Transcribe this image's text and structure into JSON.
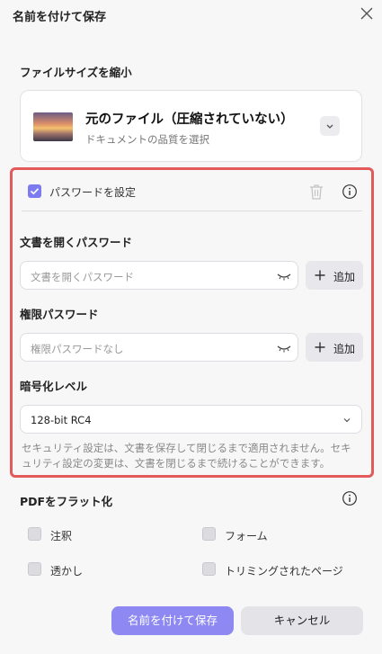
{
  "dialog": {
    "title": "名前を付けて保存"
  },
  "compress": {
    "label": "ファイルサイズを縮小",
    "option_title": "元のファイル（圧縮されていない）",
    "option_subtitle": "ドキュメントの品質を選択"
  },
  "password": {
    "checkbox_label": "パスワードを設定",
    "checked": true,
    "open_label": "文書を開くパスワード",
    "open_placeholder": "文書を開くパスワード",
    "perm_label": "権限パスワード",
    "perm_placeholder": "権限パスワードなし",
    "add_label": "追加",
    "encrypt_label": "暗号化レベル",
    "encrypt_value": "128-bit RC4",
    "note": "セキュリティ設定は、文書を保存して閉じるまで適用されません。セキュリティ設定の変更は、文書を閉じるまで続けることができます。"
  },
  "flatten": {
    "label": "PDFをフラット化",
    "options": [
      "注釈",
      "フォーム",
      "透かし",
      "トリミングされたページ"
    ]
  },
  "footer": {
    "save_label": "名前を付けて保存",
    "cancel_label": "キャンセル"
  },
  "colors": {
    "accent": "#7d7bf0",
    "save_button": "#8d88f2",
    "highlight": "#e25a5a"
  }
}
